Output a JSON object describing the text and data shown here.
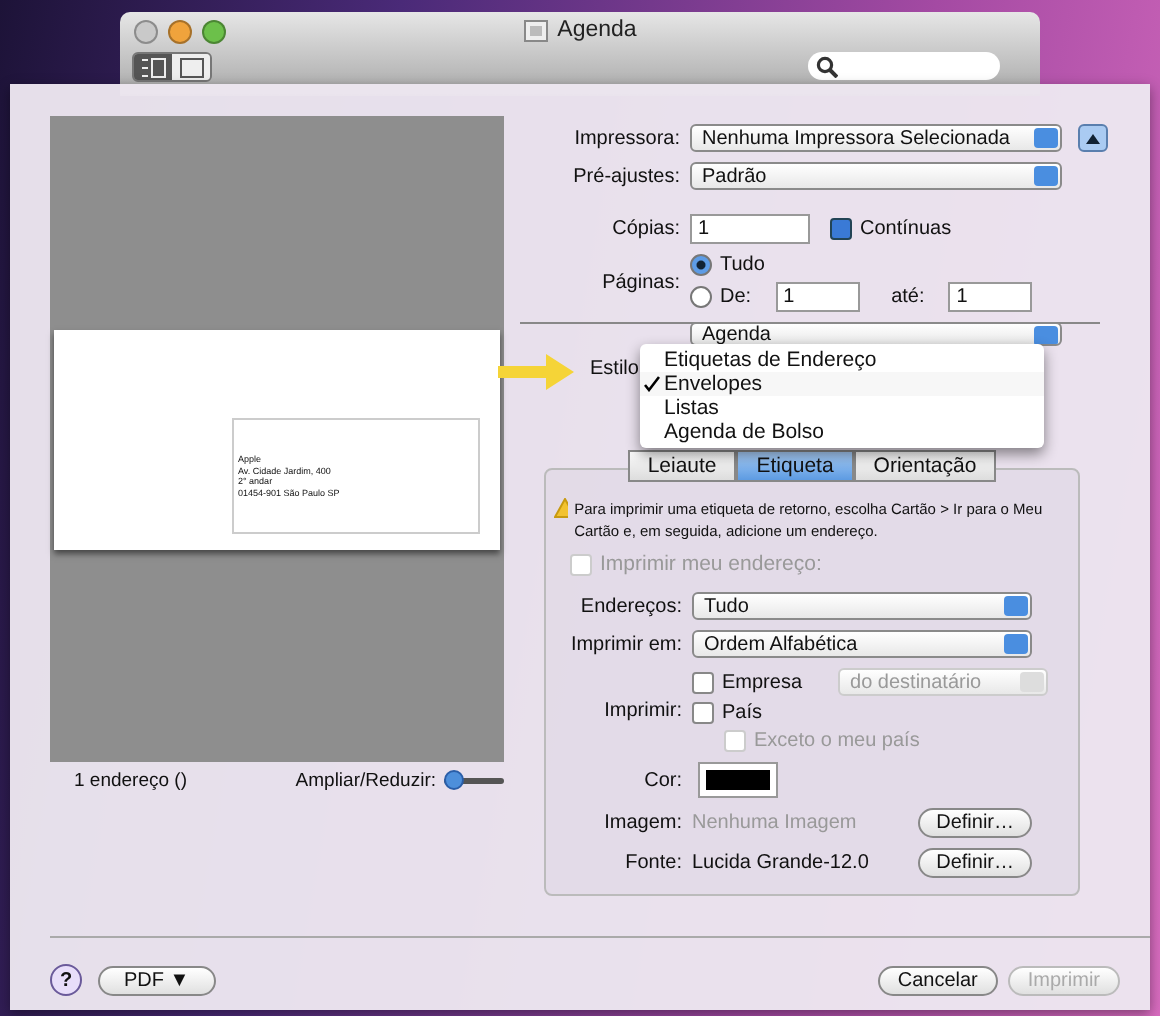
{
  "window": {
    "title": "Agenda",
    "view_buttons": [
      {
        "selected": true
      },
      {
        "selected": false
      }
    ]
  },
  "preview": {
    "address_lines": [
      "Apple",
      "Av. Cidade Jardim, 400",
      "2° andar",
      "01454-901 São Paulo SP"
    ],
    "count": "1 endereço ()",
    "zoom": {
      "label": "Ampliar/Reduzir:",
      "level": 0
    }
  },
  "printer": {
    "label": "Impressora:",
    "value": "Nenhuma Impressora Selecionada"
  },
  "presets": {
    "label": "Pré-ajustes:",
    "value": "Padrão"
  },
  "copies": {
    "label": "Cópias:",
    "value": "1",
    "collated": {
      "label": "Contínuas",
      "checked": true
    }
  },
  "pages": {
    "label": "Páginas:",
    "options": [
      {
        "label": "Tudo",
        "selected": true
      },
      {
        "label": "De:",
        "selected": false
      }
    ],
    "from": "1",
    "to_label": "até:",
    "to": "1"
  },
  "app_popup": {
    "value": "Agenda"
  },
  "style": {
    "label": "Estilo",
    "menu": [
      {
        "label": "Etiquetas de Endereço",
        "selected": false
      },
      {
        "label": "Envelopes",
        "selected": true
      },
      {
        "label": "Listas",
        "selected": false
      },
      {
        "label": "Agenda de Bolso",
        "selected": false
      }
    ]
  },
  "tabs": [
    {
      "label": "Leiaute",
      "selected": false
    },
    {
      "label": "Etiqueta",
      "selected": true
    },
    {
      "label": "Orientação",
      "selected": false
    }
  ],
  "panel": {
    "notice": "Para imprimir uma etiqueta de retorno, escolha Cartão > Ir para o Meu Cartão e, em seguida, adicione um endereço.",
    "print_my_address": {
      "label": "Imprimir meu endereço:",
      "checked": false,
      "disabled": true
    },
    "addresses": {
      "label": "Endereços:",
      "value": "Tudo"
    },
    "print_in": {
      "label": "Imprimir em:",
      "value": "Ordem Alfabética"
    },
    "print": {
      "label": "Imprimir:",
      "options": [
        {
          "label": "Empresa",
          "checked": false,
          "disabled": false
        },
        {
          "label": "País",
          "checked": false,
          "disabled": false
        },
        {
          "label": "Exceto o meu país",
          "checked": false,
          "disabled": true
        }
      ],
      "company_popup": {
        "value": "do destinatário",
        "disabled": true
      }
    },
    "color": {
      "label": "Cor:",
      "color": "#000000"
    },
    "image": {
      "label": "Imagem:",
      "value": "Nenhuma Imagem",
      "button": "Definir…"
    },
    "font": {
      "label": "Fonte:",
      "value": "Lucida Grande-12.0",
      "button": "Definir…"
    }
  },
  "footer": {
    "help": "?",
    "pdf": "PDF ▼",
    "buttons": [
      {
        "label": "Cancelar",
        "disabled": false
      },
      {
        "label": "Imprimir",
        "disabled": true
      }
    ]
  }
}
